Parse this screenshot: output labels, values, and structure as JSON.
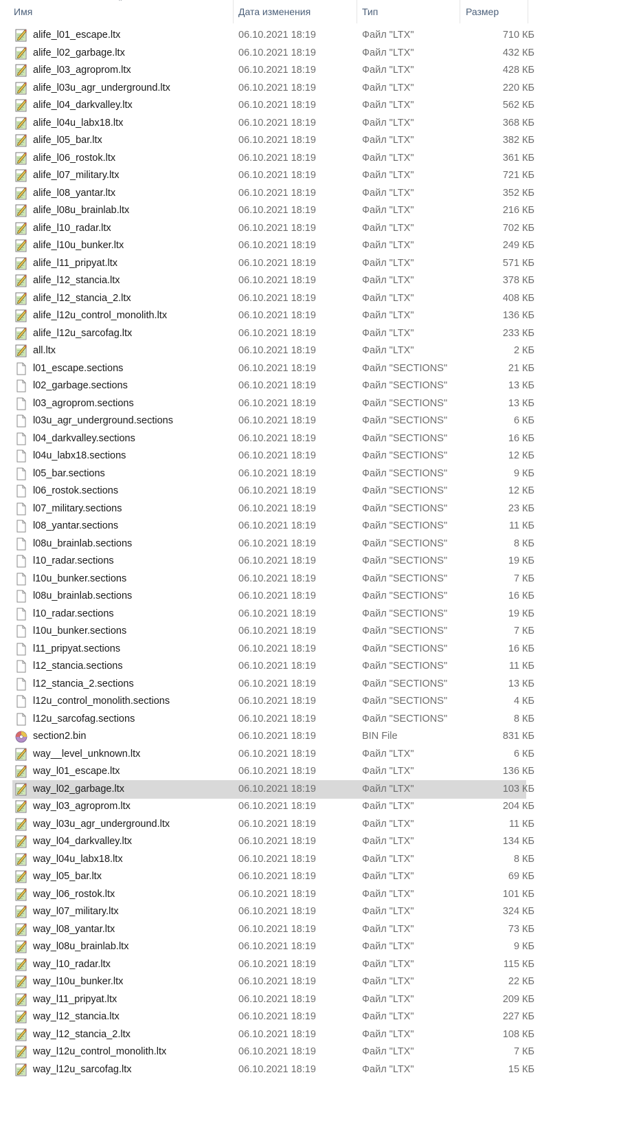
{
  "columns": {
    "name": "Имя",
    "date": "Дата изменения",
    "type": "Тип",
    "size": "Размер"
  },
  "selected_index": 43,
  "files": [
    {
      "name": "alife_l01_escape.ltx",
      "date": "06.10.2021 18:19",
      "type": "Файл \"LTX\"",
      "size": "710 КБ",
      "icon": "ltx-file-icon"
    },
    {
      "name": "alife_l02_garbage.ltx",
      "date": "06.10.2021 18:19",
      "type": "Файл \"LTX\"",
      "size": "432 КБ",
      "icon": "ltx-file-icon"
    },
    {
      "name": "alife_l03_agroprom.ltx",
      "date": "06.10.2021 18:19",
      "type": "Файл \"LTX\"",
      "size": "428 КБ",
      "icon": "ltx-file-icon"
    },
    {
      "name": "alife_l03u_agr_underground.ltx",
      "date": "06.10.2021 18:19",
      "type": "Файл \"LTX\"",
      "size": "220 КБ",
      "icon": "ltx-file-icon"
    },
    {
      "name": "alife_l04_darkvalley.ltx",
      "date": "06.10.2021 18:19",
      "type": "Файл \"LTX\"",
      "size": "562 КБ",
      "icon": "ltx-file-icon"
    },
    {
      "name": "alife_l04u_labx18.ltx",
      "date": "06.10.2021 18:19",
      "type": "Файл \"LTX\"",
      "size": "368 КБ",
      "icon": "ltx-file-icon"
    },
    {
      "name": "alife_l05_bar.ltx",
      "date": "06.10.2021 18:19",
      "type": "Файл \"LTX\"",
      "size": "382 КБ",
      "icon": "ltx-file-icon"
    },
    {
      "name": "alife_l06_rostok.ltx",
      "date": "06.10.2021 18:19",
      "type": "Файл \"LTX\"",
      "size": "361 КБ",
      "icon": "ltx-file-icon"
    },
    {
      "name": "alife_l07_military.ltx",
      "date": "06.10.2021 18:19",
      "type": "Файл \"LTX\"",
      "size": "721 КБ",
      "icon": "ltx-file-icon"
    },
    {
      "name": "alife_l08_yantar.ltx",
      "date": "06.10.2021 18:19",
      "type": "Файл \"LTX\"",
      "size": "352 КБ",
      "icon": "ltx-file-icon"
    },
    {
      "name": "alife_l08u_brainlab.ltx",
      "date": "06.10.2021 18:19",
      "type": "Файл \"LTX\"",
      "size": "216 КБ",
      "icon": "ltx-file-icon"
    },
    {
      "name": "alife_l10_radar.ltx",
      "date": "06.10.2021 18:19",
      "type": "Файл \"LTX\"",
      "size": "702 КБ",
      "icon": "ltx-file-icon"
    },
    {
      "name": "alife_l10u_bunker.ltx",
      "date": "06.10.2021 18:19",
      "type": "Файл \"LTX\"",
      "size": "249 КБ",
      "icon": "ltx-file-icon"
    },
    {
      "name": "alife_l11_pripyat.ltx",
      "date": "06.10.2021 18:19",
      "type": "Файл \"LTX\"",
      "size": "571 КБ",
      "icon": "ltx-file-icon"
    },
    {
      "name": "alife_l12_stancia.ltx",
      "date": "06.10.2021 18:19",
      "type": "Файл \"LTX\"",
      "size": "378 КБ",
      "icon": "ltx-file-icon"
    },
    {
      "name": "alife_l12_stancia_2.ltx",
      "date": "06.10.2021 18:19",
      "type": "Файл \"LTX\"",
      "size": "408 КБ",
      "icon": "ltx-file-icon"
    },
    {
      "name": "alife_l12u_control_monolith.ltx",
      "date": "06.10.2021 18:19",
      "type": "Файл \"LTX\"",
      "size": "136 КБ",
      "icon": "ltx-file-icon"
    },
    {
      "name": "alife_l12u_sarcofag.ltx",
      "date": "06.10.2021 18:19",
      "type": "Файл \"LTX\"",
      "size": "233 КБ",
      "icon": "ltx-file-icon"
    },
    {
      "name": "all.ltx",
      "date": "06.10.2021 18:19",
      "type": "Файл \"LTX\"",
      "size": "2 КБ",
      "icon": "ltx-file-icon"
    },
    {
      "name": "l01_escape.sections",
      "date": "06.10.2021 18:19",
      "type": "Файл \"SECTIONS\"",
      "size": "21 КБ",
      "icon": "blank-file-icon"
    },
    {
      "name": "l02_garbage.sections",
      "date": "06.10.2021 18:19",
      "type": "Файл \"SECTIONS\"",
      "size": "13 КБ",
      "icon": "blank-file-icon"
    },
    {
      "name": "l03_agroprom.sections",
      "date": "06.10.2021 18:19",
      "type": "Файл \"SECTIONS\"",
      "size": "13 КБ",
      "icon": "blank-file-icon"
    },
    {
      "name": "l03u_agr_underground.sections",
      "date": "06.10.2021 18:19",
      "type": "Файл \"SECTIONS\"",
      "size": "6 КБ",
      "icon": "blank-file-icon"
    },
    {
      "name": "l04_darkvalley.sections",
      "date": "06.10.2021 18:19",
      "type": "Файл \"SECTIONS\"",
      "size": "16 КБ",
      "icon": "blank-file-icon"
    },
    {
      "name": "l04u_labx18.sections",
      "date": "06.10.2021 18:19",
      "type": "Файл \"SECTIONS\"",
      "size": "12 КБ",
      "icon": "blank-file-icon"
    },
    {
      "name": "l05_bar.sections",
      "date": "06.10.2021 18:19",
      "type": "Файл \"SECTIONS\"",
      "size": "9 КБ",
      "icon": "blank-file-icon"
    },
    {
      "name": "l06_rostok.sections",
      "date": "06.10.2021 18:19",
      "type": "Файл \"SECTIONS\"",
      "size": "12 КБ",
      "icon": "blank-file-icon"
    },
    {
      "name": "l07_military.sections",
      "date": "06.10.2021 18:19",
      "type": "Файл \"SECTIONS\"",
      "size": "23 КБ",
      "icon": "blank-file-icon"
    },
    {
      "name": "l08_yantar.sections",
      "date": "06.10.2021 18:19",
      "type": "Файл \"SECTIONS\"",
      "size": "11 КБ",
      "icon": "blank-file-icon"
    },
    {
      "name": "l08u_brainlab.sections",
      "date": "06.10.2021 18:19",
      "type": "Файл \"SECTIONS\"",
      "size": "8 КБ",
      "icon": "blank-file-icon"
    },
    {
      "name": "l10_radar.sections",
      "date": "06.10.2021 18:19",
      "type": "Файл \"SECTIONS\"",
      "size": "19 КБ",
      "icon": "blank-file-icon"
    },
    {
      "name": "l10u_bunker.sections",
      "date": "06.10.2021 18:19",
      "type": "Файл \"SECTIONS\"",
      "size": "7 КБ",
      "icon": "blank-file-icon"
    },
    {
      "name": "l08u_brainlab.sections",
      "date": "06.10.2021 18:19",
      "type": "Файл \"SECTIONS\"",
      "size": "16 КБ",
      "icon": "blank-file-icon"
    },
    {
      "name": "l10_radar.sections",
      "date": "06.10.2021 18:19",
      "type": "Файл \"SECTIONS\"",
      "size": "19 КБ",
      "icon": "blank-file-icon"
    },
    {
      "name": "l10u_bunker.sections",
      "date": "06.10.2021 18:19",
      "type": "Файл \"SECTIONS\"",
      "size": "7 КБ",
      "icon": "blank-file-icon"
    },
    {
      "name": "l11_pripyat.sections",
      "date": "06.10.2021 18:19",
      "type": "Файл \"SECTIONS\"",
      "size": "16 КБ",
      "icon": "blank-file-icon"
    },
    {
      "name": "l12_stancia.sections",
      "date": "06.10.2021 18:19",
      "type": "Файл \"SECTIONS\"",
      "size": "11 КБ",
      "icon": "blank-file-icon"
    },
    {
      "name": "l12_stancia_2.sections",
      "date": "06.10.2021 18:19",
      "type": "Файл \"SECTIONS\"",
      "size": "13 КБ",
      "icon": "blank-file-icon"
    },
    {
      "name": "l12u_control_monolith.sections",
      "date": "06.10.2021 18:19",
      "type": "Файл \"SECTIONS\"",
      "size": "4 КБ",
      "icon": "blank-file-icon"
    },
    {
      "name": "l12u_sarcofag.sections",
      "date": "06.10.2021 18:19",
      "type": "Файл \"SECTIONS\"",
      "size": "8 КБ",
      "icon": "blank-file-icon"
    },
    {
      "name": "section2.bin",
      "date": "06.10.2021 18:19",
      "type": "BIN File",
      "size": "831 КБ",
      "icon": "disc-file-icon"
    },
    {
      "name": "way__level_unknown.ltx",
      "date": "06.10.2021 18:19",
      "type": "Файл \"LTX\"",
      "size": "6 КБ",
      "icon": "ltx-file-icon"
    },
    {
      "name": "way_l01_escape.ltx",
      "date": "06.10.2021 18:19",
      "type": "Файл \"LTX\"",
      "size": "136 КБ",
      "icon": "ltx-file-icon"
    },
    {
      "name": "way_l02_garbage.ltx",
      "date": "06.10.2021 18:19",
      "type": "Файл \"LTX\"",
      "size": "103 КБ",
      "icon": "ltx-file-icon"
    },
    {
      "name": "way_l03_agroprom.ltx",
      "date": "06.10.2021 18:19",
      "type": "Файл \"LTX\"",
      "size": "204 КБ",
      "icon": "ltx-file-icon"
    },
    {
      "name": "way_l03u_agr_underground.ltx",
      "date": "06.10.2021 18:19",
      "type": "Файл \"LTX\"",
      "size": "11 КБ",
      "icon": "ltx-file-icon"
    },
    {
      "name": "way_l04_darkvalley.ltx",
      "date": "06.10.2021 18:19",
      "type": "Файл \"LTX\"",
      "size": "134 КБ",
      "icon": "ltx-file-icon"
    },
    {
      "name": "way_l04u_labx18.ltx",
      "date": "06.10.2021 18:19",
      "type": "Файл \"LTX\"",
      "size": "8 КБ",
      "icon": "ltx-file-icon"
    },
    {
      "name": "way_l05_bar.ltx",
      "date": "06.10.2021 18:19",
      "type": "Файл \"LTX\"",
      "size": "69 КБ",
      "icon": "ltx-file-icon"
    },
    {
      "name": "way_l06_rostok.ltx",
      "date": "06.10.2021 18:19",
      "type": "Файл \"LTX\"",
      "size": "101 КБ",
      "icon": "ltx-file-icon"
    },
    {
      "name": "way_l07_military.ltx",
      "date": "06.10.2021 18:19",
      "type": "Файл \"LTX\"",
      "size": "324 КБ",
      "icon": "ltx-file-icon"
    },
    {
      "name": "way_l08_yantar.ltx",
      "date": "06.10.2021 18:19",
      "type": "Файл \"LTX\"",
      "size": "73 КБ",
      "icon": "ltx-file-icon"
    },
    {
      "name": "way_l08u_brainlab.ltx",
      "date": "06.10.2021 18:19",
      "type": "Файл \"LTX\"",
      "size": "9 КБ",
      "icon": "ltx-file-icon"
    },
    {
      "name": "way_l10_radar.ltx",
      "date": "06.10.2021 18:19",
      "type": "Файл \"LTX\"",
      "size": "115 КБ",
      "icon": "ltx-file-icon"
    },
    {
      "name": "way_l10u_bunker.ltx",
      "date": "06.10.2021 18:19",
      "type": "Файл \"LTX\"",
      "size": "22 КБ",
      "icon": "ltx-file-icon"
    },
    {
      "name": "way_l11_pripyat.ltx",
      "date": "06.10.2021 18:19",
      "type": "Файл \"LTX\"",
      "size": "209 КБ",
      "icon": "ltx-file-icon"
    },
    {
      "name": "way_l12_stancia.ltx",
      "date": "06.10.2021 18:19",
      "type": "Файл \"LTX\"",
      "size": "227 КБ",
      "icon": "ltx-file-icon"
    },
    {
      "name": "way_l12_stancia_2.ltx",
      "date": "06.10.2021 18:19",
      "type": "Файл \"LTX\"",
      "size": "108 КБ",
      "icon": "ltx-file-icon"
    },
    {
      "name": "way_l12u_control_monolith.ltx",
      "date": "06.10.2021 18:19",
      "type": "Файл \"LTX\"",
      "size": "7 КБ",
      "icon": "ltx-file-icon"
    },
    {
      "name": "way_l12u_sarcofag.ltx",
      "date": "06.10.2021 18:19",
      "type": "Файл \"LTX\"",
      "size": "15 КБ",
      "icon": "ltx-file-icon"
    }
  ]
}
